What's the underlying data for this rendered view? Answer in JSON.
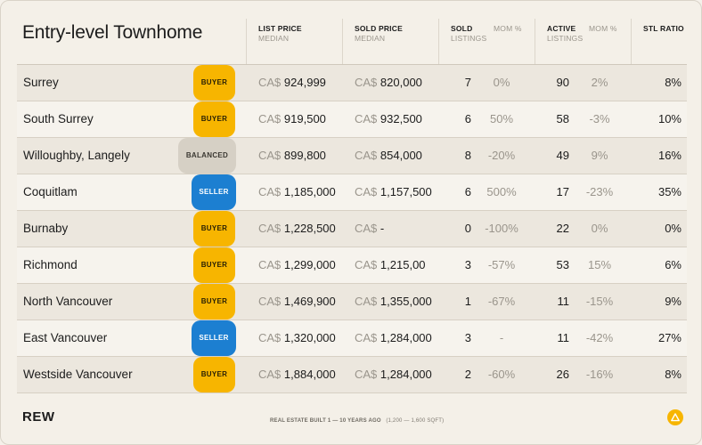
{
  "title": "Entry-level Townhome",
  "headers": {
    "list_price": "LIST PRICE",
    "list_price_sub": "MEDIAN",
    "sold_price": "SOLD PRICE",
    "sold_price_sub": "MEDIAN",
    "sold": "SOLD",
    "sold_sub": "LISTINGS",
    "mom1": "MOM %",
    "active": "ACTIVE",
    "active_sub": "LISTINGS",
    "mom2": "MOM %",
    "stl": "STL RATIO"
  },
  "currency": "CA$",
  "rows": [
    {
      "name": "Surrey",
      "badge": "BUYER",
      "list": "924,999",
      "sold_price": "820,000",
      "sold": "7",
      "mom1": "0%",
      "active": "90",
      "mom2": "2%",
      "stl": "8%"
    },
    {
      "name": "South Surrey",
      "badge": "BUYER",
      "list": "919,500",
      "sold_price": "932,500",
      "sold": "6",
      "mom1": "50%",
      "active": "58",
      "mom2": "-3%",
      "stl": "10%"
    },
    {
      "name": "Willoughby, Langely",
      "badge": "BALANCED",
      "list": "899,800",
      "sold_price": "854,000",
      "sold": "8",
      "mom1": "-20%",
      "active": "49",
      "mom2": "9%",
      "stl": "16%"
    },
    {
      "name": "Coquitlam",
      "badge": "SELLER",
      "list": "1,185,000",
      "sold_price": "1,157,500",
      "sold": "6",
      "mom1": "500%",
      "active": "17",
      "mom2": "-23%",
      "stl": "35%"
    },
    {
      "name": "Burnaby",
      "badge": "BUYER",
      "list": "1,228,500",
      "sold_price": "-",
      "sold": "0",
      "mom1": "-100%",
      "active": "22",
      "mom2": "0%",
      "stl": "0%"
    },
    {
      "name": "Richmond",
      "badge": "BUYER",
      "list": "1,299,000",
      "sold_price": "1,215,00",
      "sold": "3",
      "mom1": "-57%",
      "active": "53",
      "mom2": "15%",
      "stl": "6%"
    },
    {
      "name": "North Vancouver",
      "badge": "BUYER",
      "list": "1,469,900",
      "sold_price": "1,355,000",
      "sold": "1",
      "mom1": "-67%",
      "active": "11",
      "mom2": "-15%",
      "stl": "9%"
    },
    {
      "name": "East Vancouver",
      "badge": "SELLER",
      "list": "1,320,000",
      "sold_price": "1,284,000",
      "sold": "3",
      "mom1": "-",
      "active": "11",
      "mom2": "-42%",
      "stl": "27%"
    },
    {
      "name": "Westside Vancouver",
      "badge": "BUYER",
      "list": "1,884,000",
      "sold_price": "1,284,000",
      "sold": "2",
      "mom1": "-60%",
      "active": "26",
      "mom2": "-16%",
      "stl": "8%"
    }
  ],
  "footer": {
    "logo": "REW",
    "note_bold": "REAL ESTATE BUILT 1 — 10 YEARS AGO",
    "note_sub": "(1,200 — 1,600 SQFT)",
    "icon": "warning-icon"
  },
  "colors": {
    "buyer": "#f7b500",
    "seller": "#1c7fd1",
    "balanced": "#d6d0c5"
  }
}
